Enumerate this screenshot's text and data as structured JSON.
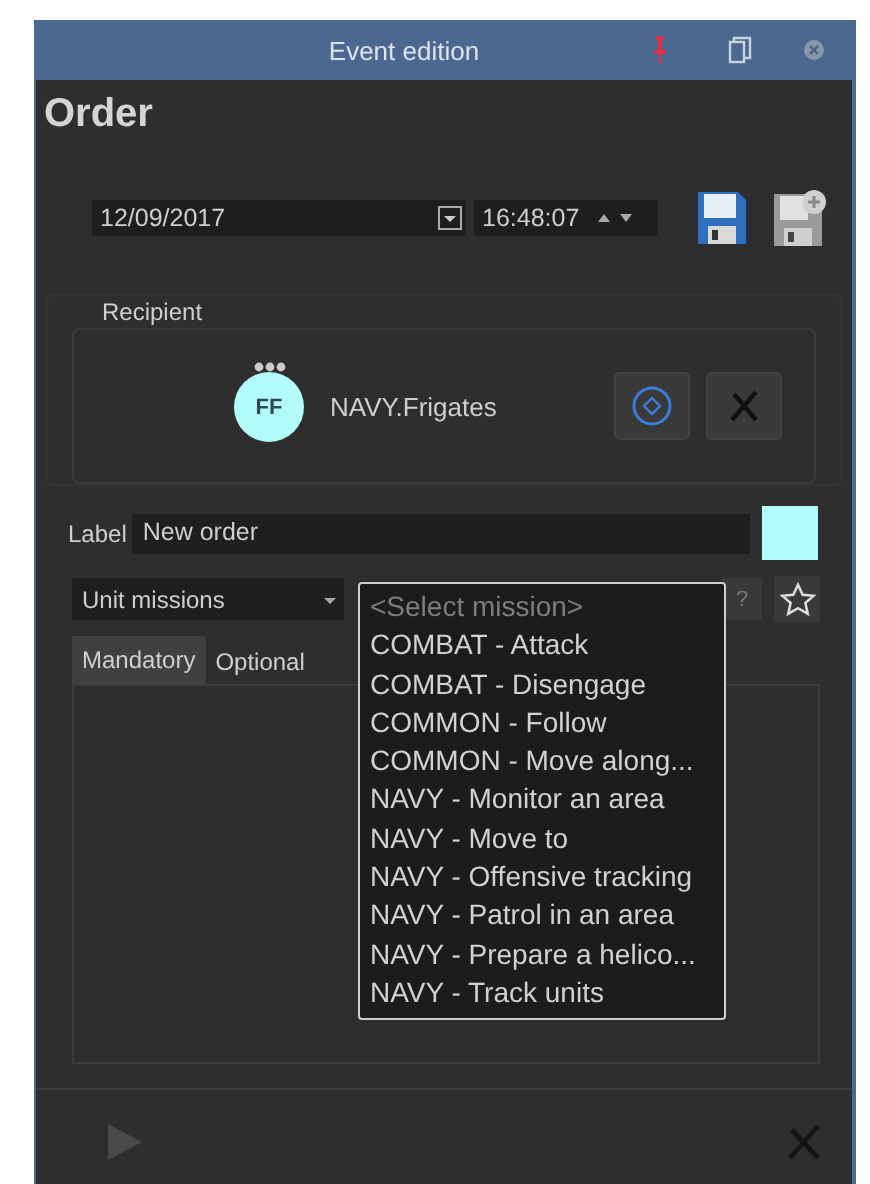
{
  "window": {
    "title": "Event edition"
  },
  "heading": "Order",
  "date": {
    "value": "12/09/2017"
  },
  "time": {
    "value": "16:48:07"
  },
  "recipient": {
    "title": "Recipient",
    "avatar": "FF",
    "name": "NAVY.Frigates"
  },
  "label": {
    "caption": "Label",
    "value": "New order",
    "color": "#b3fcfc"
  },
  "category": {
    "value": "Unit missions"
  },
  "help": "?",
  "tabs": [
    {
      "label": "Mandatory",
      "selected": true
    },
    {
      "label": "Optional",
      "selected": false
    }
  ],
  "mission_dropdown": {
    "placeholder": "<Select mission>",
    "options": [
      "COMBAT - Attack",
      "COMBAT - Disengage",
      "COMMON - Follow",
      "COMMON - Move along...",
      "NAVY - Monitor an area",
      "NAVY - Move to",
      "NAVY - Offensive tracking",
      "NAVY - Patrol in an area",
      "NAVY - Prepare a helico...",
      "NAVY - Track units"
    ]
  }
}
